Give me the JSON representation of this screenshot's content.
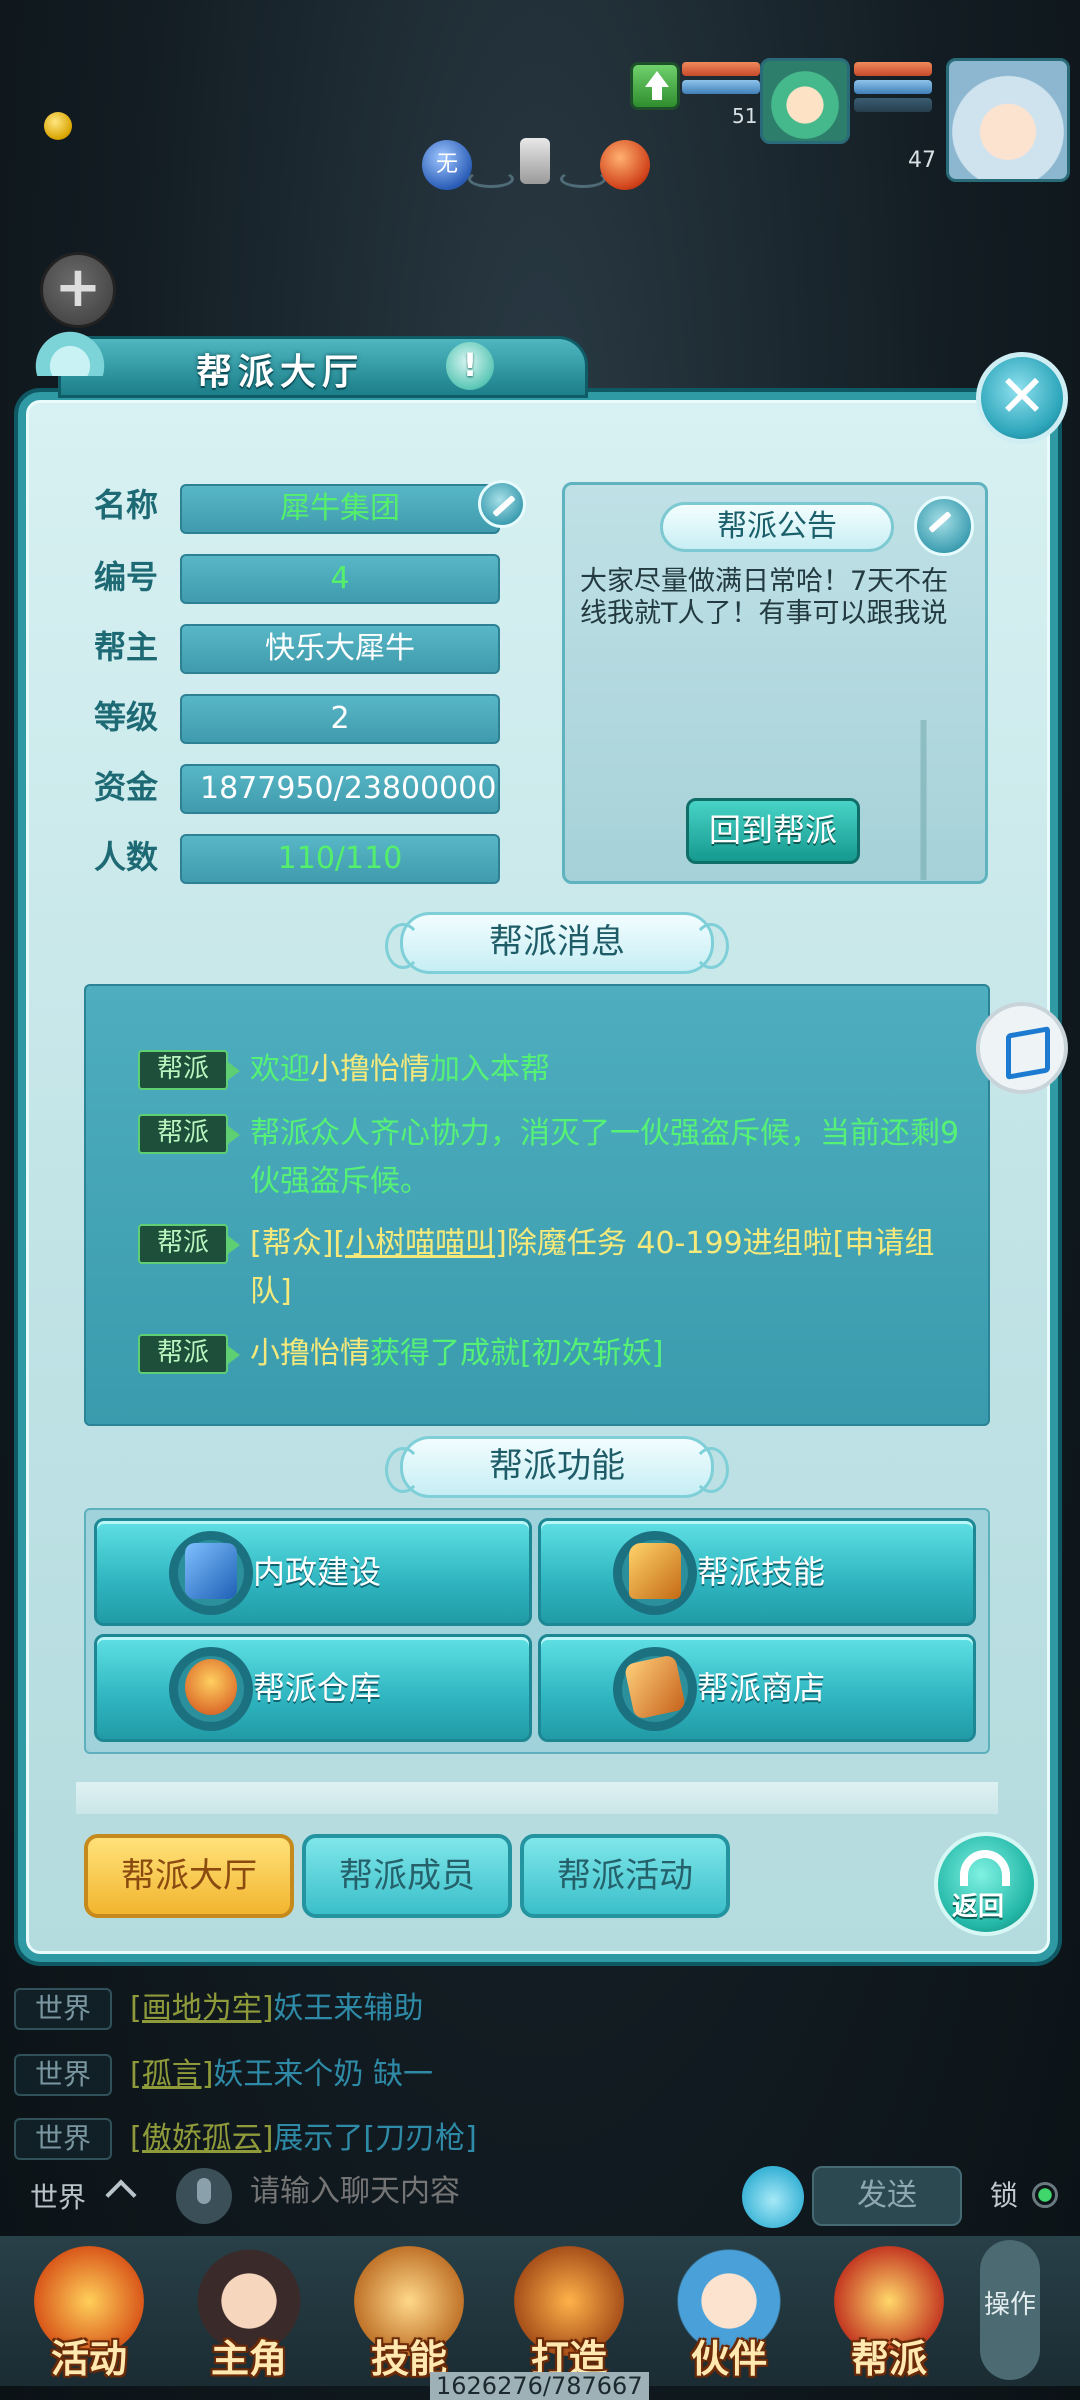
{
  "hud": {
    "buff_label": "无",
    "pet_level": "51",
    "player_level": "47"
  },
  "window": {
    "title": "帮派大厅",
    "help": "!",
    "close": "✕"
  },
  "info": {
    "labels": {
      "name": "名称",
      "id": "编号",
      "leader": "帮主",
      "level": "等级",
      "funds": "资金",
      "members": "人数"
    },
    "values": {
      "name": "犀牛集团",
      "id": "4",
      "leader": "快乐大犀牛",
      "level": "2",
      "funds": "1877950/23800000",
      "members": "110/110"
    }
  },
  "notice": {
    "title": "帮派公告",
    "text": "大家尽量做满日常哈！7天不在线我就T人了！有事可以跟我说",
    "return_button": "回到帮派"
  },
  "messages": {
    "title": "帮派消息",
    "tag": "帮派",
    "items": [
      {
        "p1": "欢迎",
        "p2": "小撸怡情",
        "p3": "加入本帮"
      },
      {
        "text": "帮派众人齐心协力，消灭了一伙强盗斥候，当前还剩9伙强盗斥候。"
      },
      {
        "p1": "[帮众]",
        "p2": "[小树喵喵叫]",
        "p3": "除魔任务 40-199进组啦",
        "p4": "[申请组队]"
      },
      {
        "p1": "小撸怡情",
        "p2": "获得了成就",
        "p3": "[初次斩妖]"
      }
    ]
  },
  "functions": {
    "title": "帮派功能",
    "items": [
      "内政建设",
      "帮派技能",
      "帮派仓库",
      "帮派商店"
    ]
  },
  "tabs": {
    "hall": "帮派大厅",
    "members": "帮派成员",
    "activities": "帮派活动",
    "active": "hall"
  },
  "back_button": "返回",
  "chat": {
    "channel_tag": "世界",
    "lines": [
      {
        "name": "[画地为牢]",
        "msg": "妖王来辅助"
      },
      {
        "name": "[孤言]",
        "msg": "妖王来个奶 缺一"
      },
      {
        "name": "[傲娇孤云]",
        "msg": "展示了[刀刃枪]"
      }
    ],
    "channel_switch": "世界",
    "input_placeholder": "请输入聊天内容",
    "send": "发送",
    "lock": "锁"
  },
  "bottom_nav": {
    "items": [
      "活动",
      "主角",
      "技能",
      "打造",
      "伙伴",
      "帮派"
    ],
    "side": "操作"
  },
  "coords": "1626276/787667",
  "colors": {
    "window_border": "#2f9aa3",
    "field_bg": "#4ba9ba",
    "message_green": "#56f275",
    "message_yellow": "#f4e97a",
    "active_tab": "#f2b52f"
  }
}
